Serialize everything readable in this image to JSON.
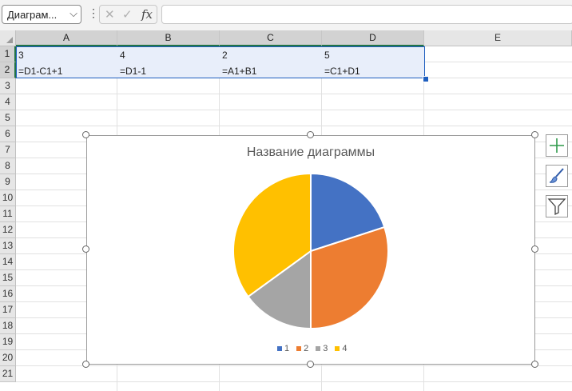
{
  "formula_bar": {
    "name_box": "Диаграм...",
    "cancel_icon": "x-icon",
    "confirm_icon": "check-icon",
    "fx_label": "fx",
    "formula": ""
  },
  "columns": [
    "A",
    "B",
    "C",
    "D",
    "E"
  ],
  "rows": [
    "1",
    "2",
    "3",
    "4",
    "5",
    "6",
    "7",
    "8",
    "9",
    "10",
    "11",
    "12",
    "13",
    "14",
    "15",
    "16",
    "17",
    "18",
    "19",
    "20",
    "21"
  ],
  "cells": {
    "A1": "3",
    "B1": "4",
    "C1": "2",
    "D1": "5",
    "A2": "=D1-C1+1",
    "B2": "=D1-1",
    "C2": "=A1+B1",
    "D2": "=C1+D1"
  },
  "selection": {
    "range": "A1:D2",
    "color": "#1f5fbf"
  },
  "chart_data": {
    "type": "pie",
    "title": "Название диаграммы",
    "categories": [
      "1",
      "2",
      "3",
      "4"
    ],
    "values": [
      4,
      6,
      3,
      7
    ],
    "colors": [
      "#4472c4",
      "#ed7d31",
      "#a5a5a5",
      "#ffc000"
    ],
    "legend_position": "bottom"
  },
  "chart_tools": [
    "plus-icon",
    "brush-icon",
    "filter-icon"
  ]
}
